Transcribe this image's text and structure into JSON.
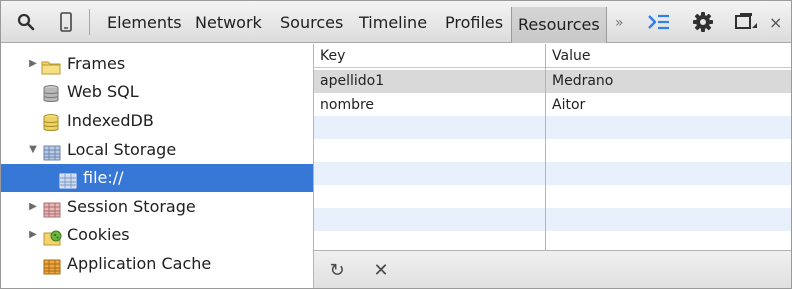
{
  "toolbar": {
    "tabs": [
      {
        "label": "Elements"
      },
      {
        "label": "Network"
      },
      {
        "label": "Sources"
      },
      {
        "label": "Timeline"
      },
      {
        "label": "Profiles"
      },
      {
        "label": "Resources"
      }
    ],
    "overflow_label": "»",
    "close_label": "×",
    "icons": [
      "search-icon",
      "device-icon",
      "console-drawer-icon",
      "gear-icon",
      "undock-icon",
      "close-icon"
    ]
  },
  "sidebar": {
    "items": [
      {
        "label": "Frames",
        "icon": "folder-icon"
      },
      {
        "label": "Web SQL",
        "icon": "database-icon"
      },
      {
        "label": "IndexedDB",
        "icon": "database-icon"
      },
      {
        "label": "Local Storage",
        "icon": "grid-icon"
      },
      {
        "label": "file://",
        "icon": "grid-icon"
      },
      {
        "label": "Session Storage",
        "icon": "grid-icon"
      },
      {
        "label": "Cookies",
        "icon": "cookie-icon"
      },
      {
        "label": "Application Cache",
        "icon": "grid-icon"
      }
    ],
    "selected": "file://"
  },
  "grid": {
    "columns": [
      "Key",
      "Value"
    ],
    "rows": [
      [
        "apellido1",
        "Medrano"
      ],
      [
        "nombre",
        "Aitor"
      ]
    ]
  },
  "statusbar": {
    "refresh_label": "↻",
    "delete_label": "✕"
  },
  "colors": {
    "selection": "#3777d6",
    "stripe": "#e8f0fb",
    "accent": "#2f80ed"
  }
}
